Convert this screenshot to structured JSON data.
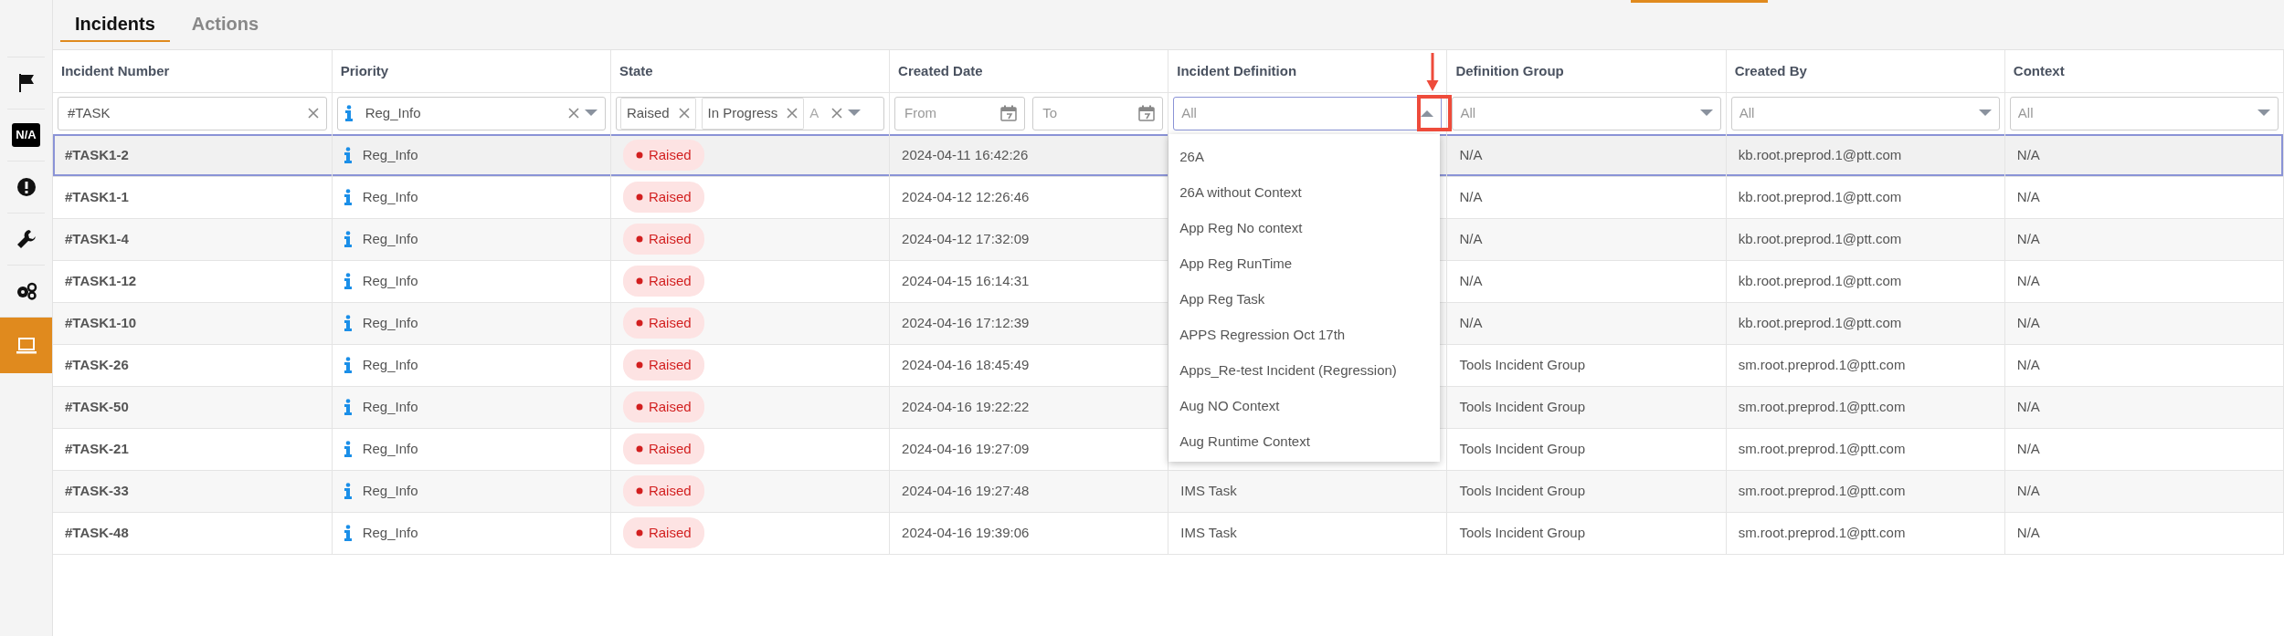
{
  "sidebar": {
    "items": [
      {
        "selected": false
      },
      {
        "label": "N/A",
        "selected": false
      },
      {
        "selected": false
      },
      {
        "selected": false
      },
      {
        "selected": false
      },
      {
        "selected": true
      }
    ]
  },
  "tabs": [
    {
      "label": "Incidents",
      "selected": true
    },
    {
      "label": "Actions",
      "selected": false
    }
  ],
  "table": {
    "columns": [
      "Incident Number",
      "Priority",
      "State",
      "Created Date",
      "Incident Definition",
      "Definition Group",
      "Created By",
      "Context"
    ],
    "filters": [
      {
        "kind": "text",
        "value": "#TASK",
        "clearable": true
      },
      {
        "kind": "select",
        "value": "Reg_Info",
        "clearable": true
      },
      {
        "kind": "chips",
        "chips": [
          "Raised",
          "In Progress",
          "A"
        ],
        "clearable": true
      },
      {
        "kind": "daterange",
        "placeholders": [
          "From",
          "To"
        ]
      },
      {
        "kind": "select",
        "placeholder": "All",
        "clearable": false,
        "expanded": true,
        "options": [
          "26A",
          "26A without Context",
          "App Reg No context",
          "App Reg RunTime",
          "App Reg Task",
          "APPS Regression Oct 17th",
          "Apps_Re-test Incident (Regression)",
          "Aug NO Context",
          "Aug Runtime Context"
        ]
      },
      {
        "kind": "select",
        "placeholder": "All",
        "clearable": false
      },
      {
        "kind": "select",
        "placeholder": "All",
        "clearable": false
      },
      {
        "kind": "select",
        "placeholder": "All",
        "clearable": false
      }
    ],
    "rows": [
      {
        "selected": true,
        "cells": [
          "#TASK1-2",
          "Reg_Info",
          "Raised",
          "2024-04-11 16:42:26",
          null,
          "N/A",
          "kb.root.preprod.1@ptt.com",
          "N/A"
        ]
      },
      {
        "selected": false,
        "cells": [
          "#TASK1-1",
          "Reg_Info",
          "Raised",
          "2024-04-12 12:26:46",
          null,
          "N/A",
          "kb.root.preprod.1@ptt.com",
          "N/A"
        ]
      },
      {
        "selected": false,
        "cells": [
          "#TASK1-4",
          "Reg_Info",
          "Raised",
          "2024-04-12 17:32:09",
          null,
          "N/A",
          "kb.root.preprod.1@ptt.com",
          "N/A"
        ]
      },
      {
        "selected": false,
        "cells": [
          "#TASK1-12",
          "Reg_Info",
          "Raised",
          "2024-04-15 16:14:31",
          null,
          "N/A",
          "kb.root.preprod.1@ptt.com",
          "N/A"
        ]
      },
      {
        "selected": false,
        "cells": [
          "#TASK1-10",
          "Reg_Info",
          "Raised",
          "2024-04-16 17:12:39",
          null,
          "N/A",
          "kb.root.preprod.1@ptt.com",
          "N/A"
        ]
      },
      {
        "selected": false,
        "cells": [
          "#TASK-26",
          "Reg_Info",
          "Raised",
          "2024-04-16 18:45:49",
          null,
          "Tools Incident Group",
          "sm.root.preprod.1@ptt.com",
          "N/A"
        ]
      },
      {
        "selected": false,
        "cells": [
          "#TASK-50",
          "Reg_Info",
          "Raised",
          "2024-04-16 19:22:22",
          null,
          "Tools Incident Group",
          "sm.root.preprod.1@ptt.com",
          "N/A"
        ]
      },
      {
        "selected": false,
        "cells": [
          "#TASK-21",
          "Reg_Info",
          "Raised",
          "2024-04-16 19:27:09",
          null,
          "Tools Incident Group",
          "sm.root.preprod.1@ptt.com",
          "N/A"
        ]
      },
      {
        "selected": false,
        "cells": [
          "#TASK-33",
          "Reg_Info",
          "Raised",
          "2024-04-16 19:27:48",
          "IMS Task",
          "Tools Incident Group",
          "sm.root.preprod.1@ptt.com",
          "N/A"
        ]
      },
      {
        "selected": false,
        "cells": [
          "#TASK-48",
          "Reg_Info",
          "Raised",
          "2024-04-16 19:39:06",
          "IMS Task",
          "Tools Incident Group",
          "sm.root.preprod.1@ptt.com",
          "N/A"
        ]
      }
    ]
  }
}
